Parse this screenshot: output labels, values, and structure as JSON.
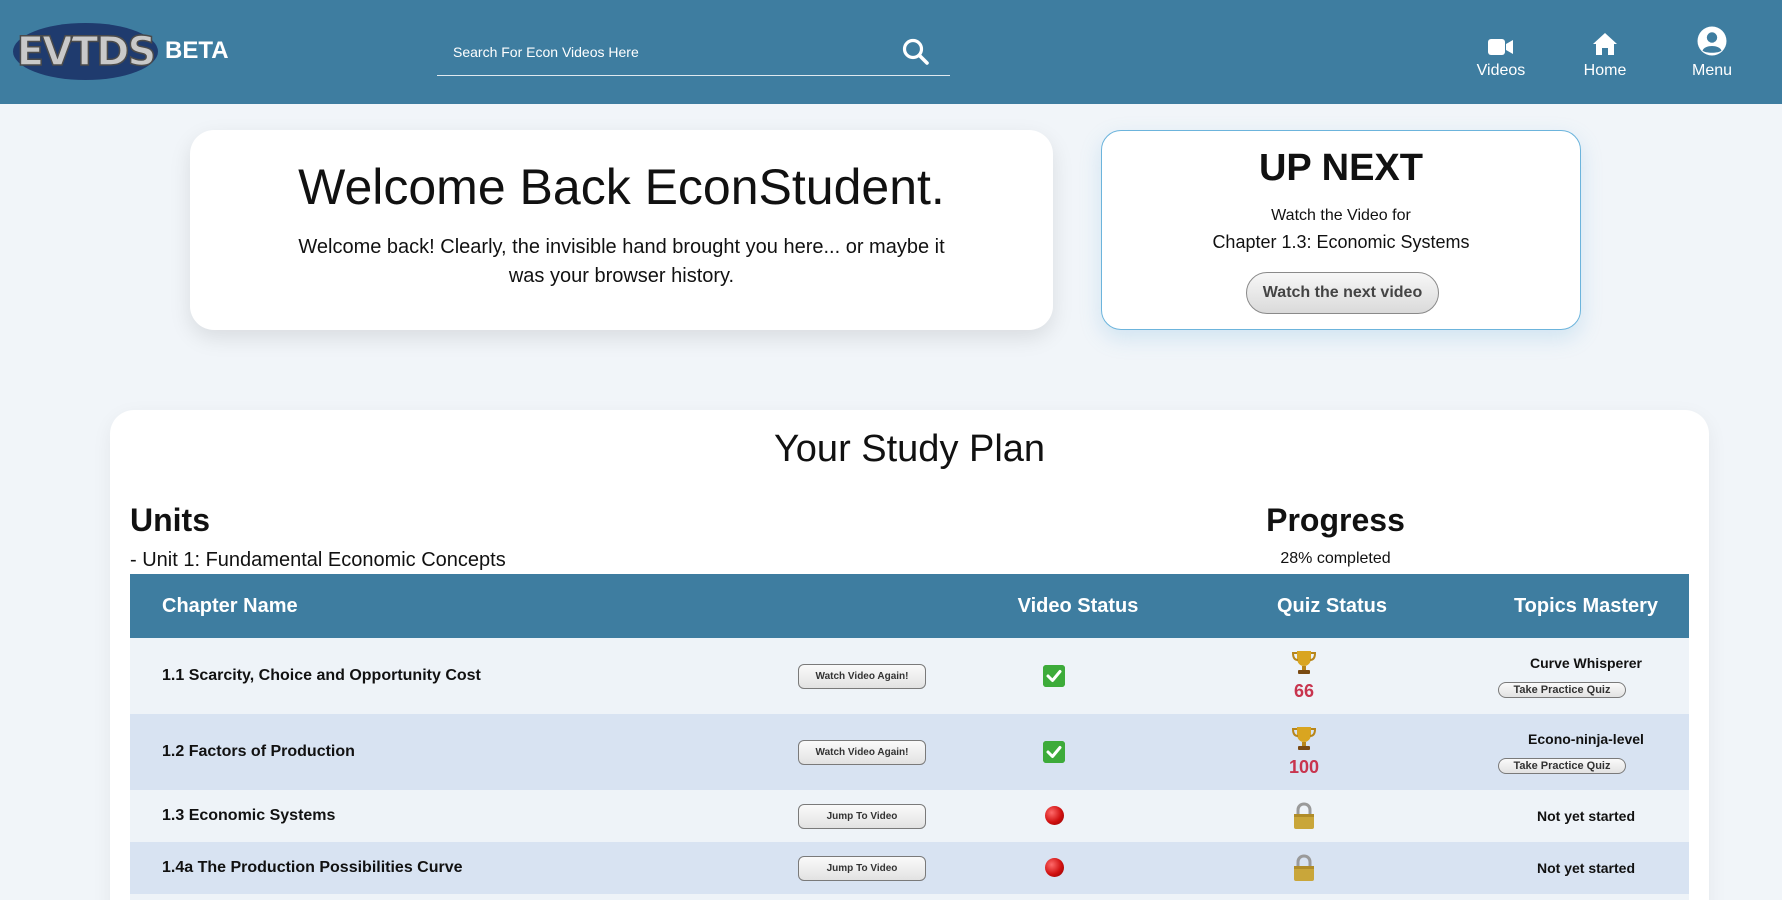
{
  "header": {
    "logo_text": "EVTDS",
    "beta_label": "BETA",
    "search_placeholder": "Search For Econ Videos Here",
    "nav": [
      {
        "label": "Videos",
        "icon": "video-camera-icon"
      },
      {
        "label": "Home",
        "icon": "home-icon"
      },
      {
        "label": "Menu",
        "icon": "user-circle-icon"
      }
    ]
  },
  "welcome": {
    "title": "Welcome Back EconStudent.",
    "message": "Welcome back! Clearly, the invisible hand brought you here... or maybe it was your browser history."
  },
  "up_next": {
    "title": "UP NEXT",
    "line1": "Watch the Video for",
    "line2": "Chapter 1.3: Economic Systems",
    "button": "Watch the next video"
  },
  "study_plan": {
    "title": "Your Study Plan",
    "units_heading": "Units",
    "unit": "- Unit 1: Fundamental Economic Concepts",
    "progress_heading": "Progress",
    "progress_text": "28% completed",
    "progress_percent": 28,
    "columns": [
      "Chapter Name",
      "Video Status",
      "Quiz Status",
      "Topics Mastery"
    ],
    "rows": [
      {
        "name": "1.1 Scarcity, Choice and Opportunity Cost",
        "button": "Watch Video Again!",
        "video_status": "complete",
        "quiz_status": "trophy",
        "score": "66",
        "mastery": "Curve Whisperer",
        "quiz_button": "Take Practice Quiz"
      },
      {
        "name": "1.2 Factors of Production",
        "button": "Watch Video Again!",
        "video_status": "complete",
        "quiz_status": "trophy",
        "score": "100",
        "mastery": "Econo-ninja-level",
        "quiz_button": "Take Practice Quiz"
      },
      {
        "name": "1.3 Economic Systems",
        "button": "Jump To Video",
        "video_status": "not-watched",
        "quiz_status": "locked",
        "mastery": "Not yet started"
      },
      {
        "name": "1.4a The Production Possibilities Curve",
        "button": "Jump To Video",
        "video_status": "not-watched",
        "quiz_status": "locked",
        "mastery": "Not yet started"
      }
    ]
  },
  "colors": {
    "header_bg": "#3e7da0",
    "page_bg": "#f1f5f9",
    "row_light": "#eef3f8",
    "row_dark": "#d8e3f2",
    "score_color": "#c8344e",
    "check_green": "#3dab3a",
    "dot_red": "#d01010"
  }
}
